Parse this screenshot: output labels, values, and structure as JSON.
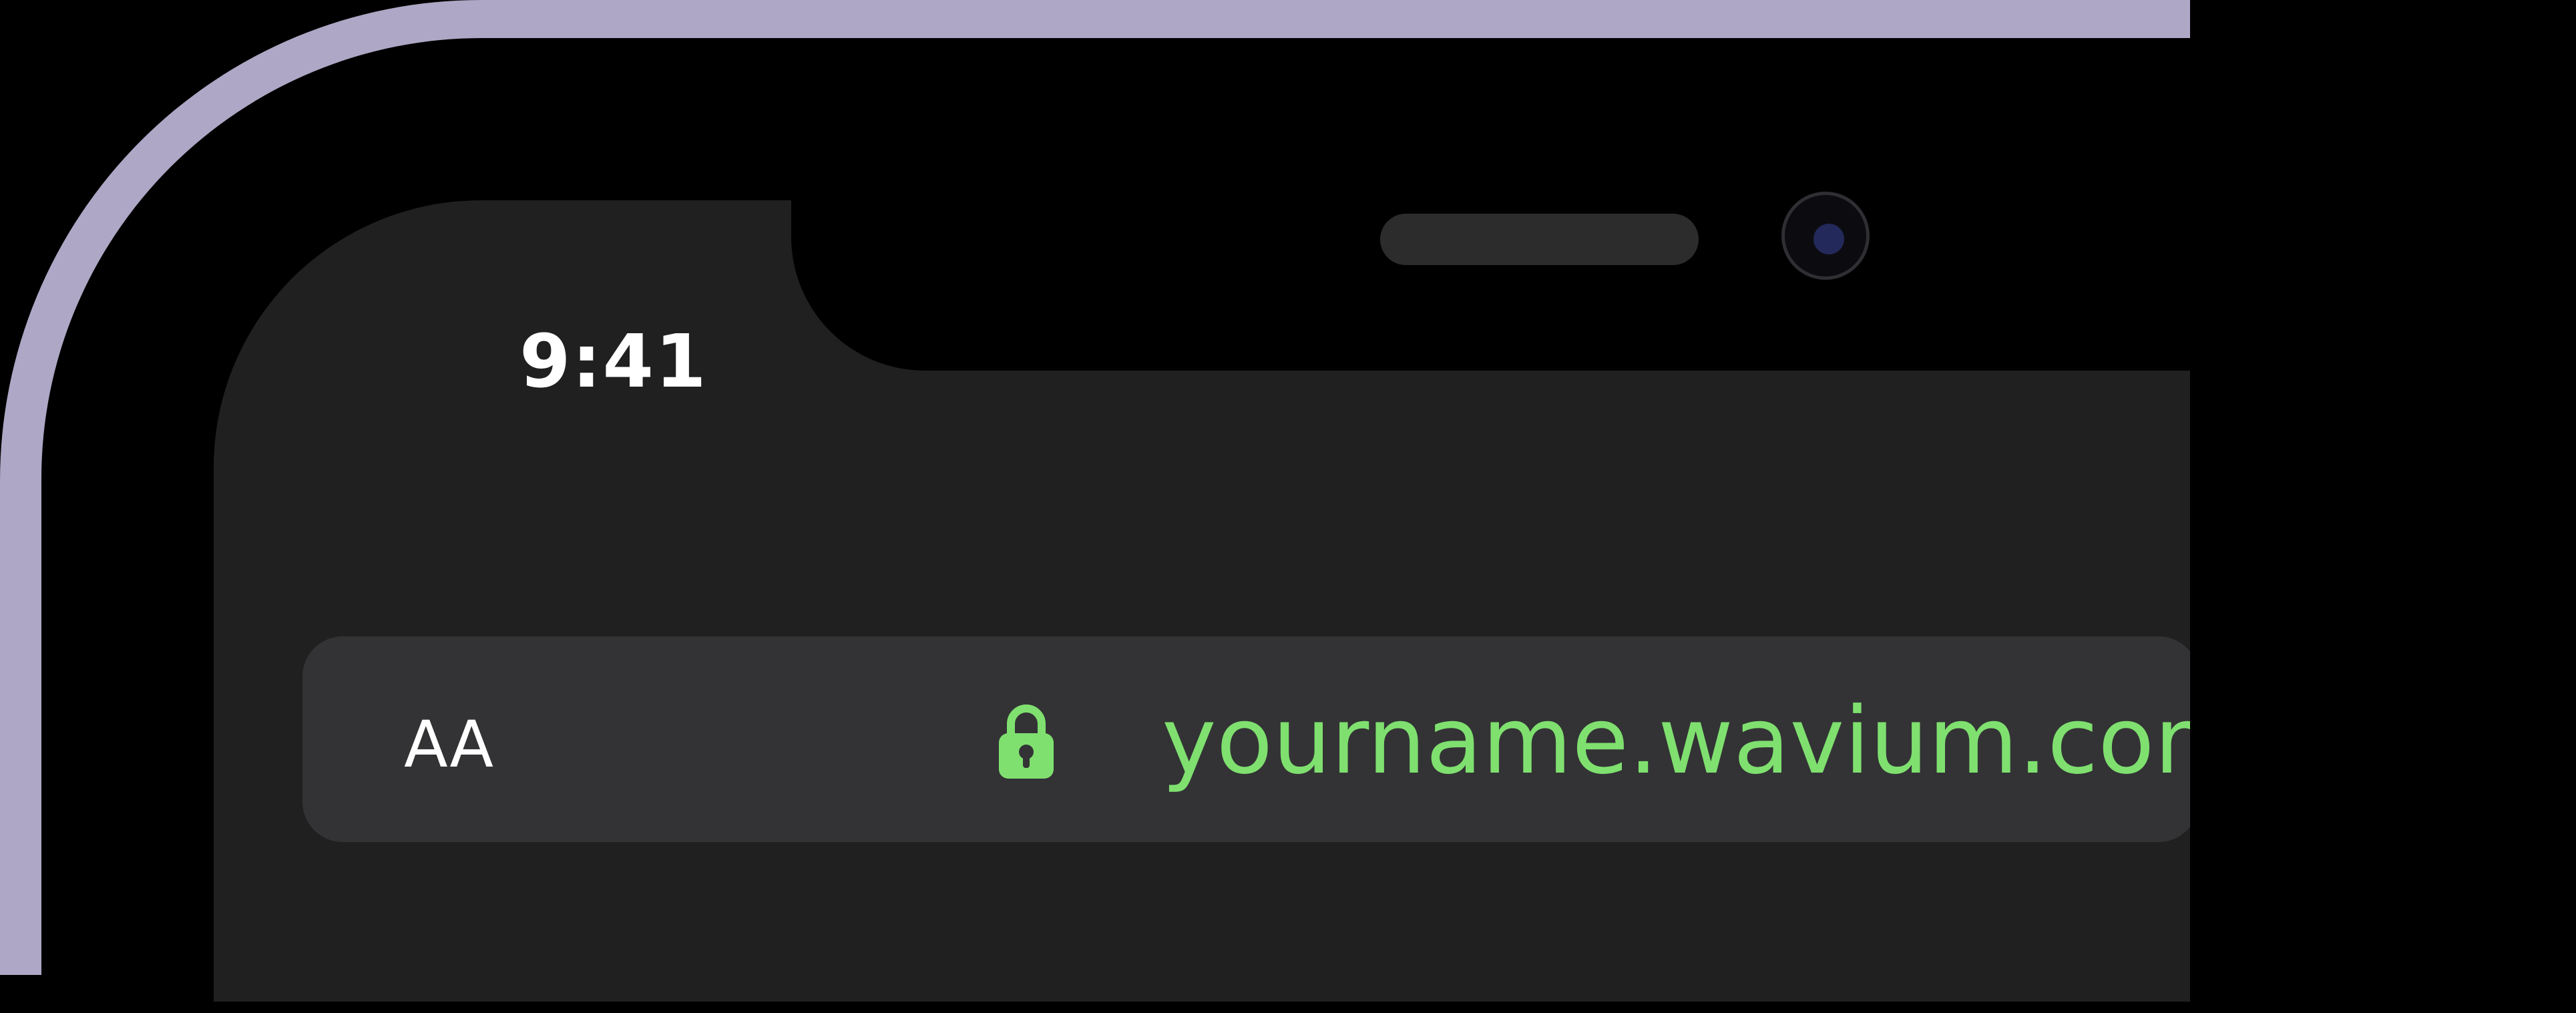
{
  "status_bar": {
    "time": "9:41"
  },
  "browser": {
    "text_size_button": "AA",
    "lock_icon": "lock-icon",
    "url": "yourname.wavium.com"
  },
  "colors": {
    "frame": "#aea7c5",
    "screen_background": "#202020",
    "address_bar": "#333335",
    "url_text": "#7fe06f",
    "lock": "#7fe06f",
    "camera_lens": "#23295a"
  }
}
